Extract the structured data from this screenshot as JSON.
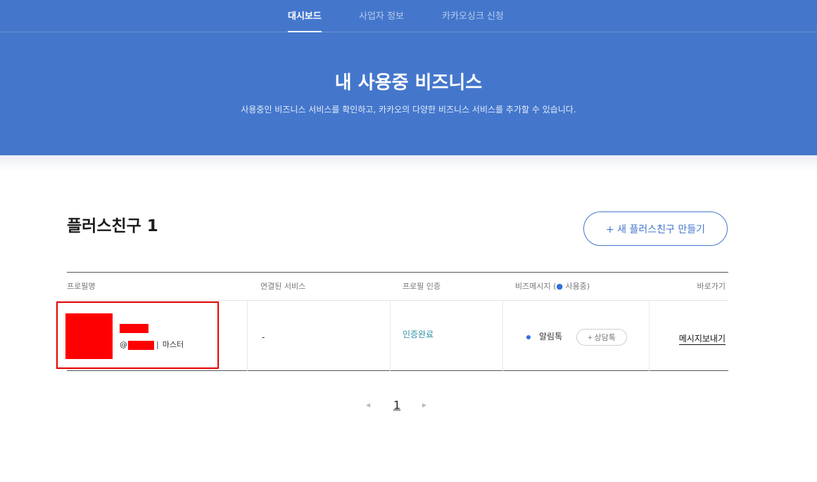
{
  "nav": {
    "items": [
      {
        "label": "대시보드",
        "active": true
      },
      {
        "label": "사업자 정보",
        "active": false
      },
      {
        "label": "카카오싱크 신청",
        "active": false
      }
    ]
  },
  "hero": {
    "title": "내 사용중 비즈니스",
    "subtitle": "사용중인 비즈니스 서비스를 확인하고, 카카오의 다양한 비즈니스 서비스를 추가할 수 있습니다."
  },
  "section": {
    "title": "플러스친구 1",
    "create_button": "+ 새 플러스친구 만들기"
  },
  "table": {
    "headers": {
      "profile": "프로필명",
      "service": "연결된 서비스",
      "verify": "프로필 인증",
      "bizmsg_prefix": "비즈메시지 (",
      "bizmsg_dot": "●",
      "bizmsg_suffix": " 사용중)",
      "shortcut": "바로가기"
    },
    "row": {
      "handle_prefix": "@",
      "role_sep": "|",
      "role": "마스터",
      "service": "-",
      "verify_status": "인증완료",
      "alimtalk": "알림톡",
      "counsel_button": "+ 상담톡",
      "send_link": "메시지보내기"
    }
  },
  "pagination": {
    "prev_icon": "◀",
    "current": "1",
    "next_icon": "▶"
  },
  "colors": {
    "hero_bg": "#4477cc",
    "accent": "#4477cc",
    "verify": "#2a8fa5",
    "redaction": "#ff0000",
    "highlight_border": "#e60000"
  }
}
